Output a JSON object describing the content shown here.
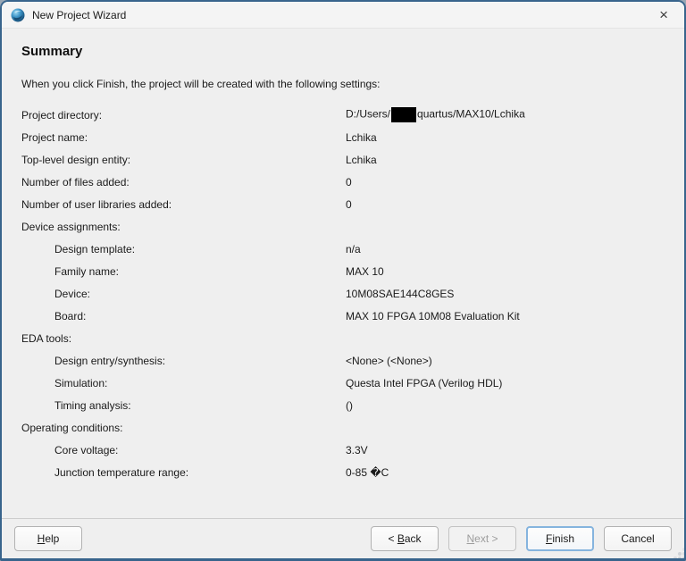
{
  "window": {
    "title": "New Project Wizard",
    "close_glyph": "×"
  },
  "header": {
    "title": "Summary",
    "description": "When you click Finish, the project will be created with the following settings:"
  },
  "summary": {
    "rows": [
      {
        "label": "Project directory:",
        "indent": 0,
        "value_parts": [
          {
            "text": "D:/Users/"
          },
          {
            "redacted": true
          },
          {
            "text": "quartus/MAX10/Lchika"
          }
        ]
      },
      {
        "label": "Project name:",
        "indent": 0,
        "value": "Lchika"
      },
      {
        "label": "Top-level design entity:",
        "indent": 0,
        "value": "Lchika"
      },
      {
        "label": "Number of files added:",
        "indent": 0,
        "value": "0"
      },
      {
        "label": "Number of user libraries added:",
        "indent": 0,
        "value": "0"
      },
      {
        "label": "Device assignments:",
        "indent": 0,
        "value": ""
      },
      {
        "label": "Design template:",
        "indent": 1,
        "value": "n/a"
      },
      {
        "label": "Family name:",
        "indent": 1,
        "value": "MAX 10"
      },
      {
        "label": "Device:",
        "indent": 1,
        "value": "10M08SAE144C8GES"
      },
      {
        "label": "Board:",
        "indent": 1,
        "value": "MAX 10 FPGA 10M08 Evaluation Kit"
      },
      {
        "label": "EDA tools:",
        "indent": 0,
        "value": ""
      },
      {
        "label": "Design entry/synthesis:",
        "indent": 1,
        "value": "<None> (<None>)"
      },
      {
        "label": "Simulation:",
        "indent": 1,
        "value": "Questa Intel FPGA (Verilog HDL)"
      },
      {
        "label": "Timing analysis:",
        "indent": 1,
        "value": "()"
      },
      {
        "label": "Operating conditions:",
        "indent": 0,
        "value": ""
      },
      {
        "label": "Core voltage:",
        "indent": 1,
        "value": "3.3V"
      },
      {
        "label": "Junction temperature range:",
        "indent": 1,
        "value": "0-85 �C"
      }
    ]
  },
  "footer": {
    "buttons": {
      "help": {
        "text": "Help",
        "underline_index": 0
      },
      "back": {
        "text": "< Back",
        "underline_index": 2
      },
      "next": {
        "text": "Next >",
        "underline_index": 0,
        "disabled": true
      },
      "finish": {
        "text": "Finish",
        "underline_index": 0,
        "default": true
      },
      "cancel": {
        "text": "Cancel",
        "underline_index": null
      }
    }
  },
  "colors": {
    "dialog_border": "#38648c",
    "default_button_focus": "#85b4de",
    "icon_blue_dark": "#1b5e8f",
    "icon_blue_light": "#7ec6e8"
  }
}
